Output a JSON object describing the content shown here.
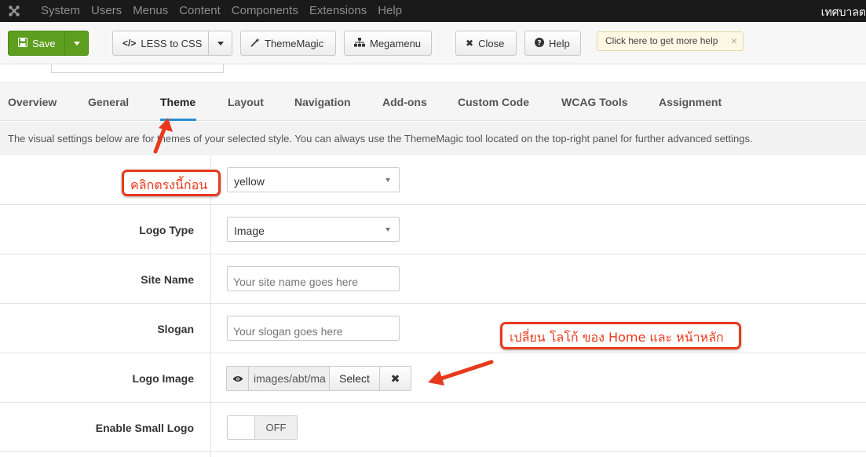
{
  "topbar": {
    "logo_icon": "joomla-icon",
    "menu": [
      "System",
      "Users",
      "Menus",
      "Content",
      "Components",
      "Extensions",
      "Help"
    ],
    "site_name": "เทศบาลต"
  },
  "toolbar": {
    "save": "Save",
    "less_to_css": "LESS to CSS",
    "theme_magic": "ThemeMagic",
    "megamenu": "Megamenu",
    "close": "Close",
    "help": "Help",
    "tip": "Click here to get more help",
    "tip_close": "×",
    "save_color": "#5e9e1f"
  },
  "tabs": {
    "items": [
      "Overview",
      "General",
      "Theme",
      "Layout",
      "Navigation",
      "Add-ons",
      "Custom Code",
      "WCAG Tools",
      "Assignment"
    ],
    "active": "Theme",
    "active_color": "#2c8fd4"
  },
  "description": "The visual settings below are for themes of your selected style. You can always use the ThemeMagic tool located on the top-right panel for further advanced settings.",
  "form": {
    "theme_value": "yellow",
    "logo_type_label": "Logo Type",
    "logo_type_value": "Image",
    "site_name_label": "Site Name",
    "site_name_placeholder": "Your site name goes here",
    "slogan_label": "Slogan",
    "slogan_placeholder": "Your slogan goes here",
    "logo_image_label": "Logo Image",
    "logo_image_value": "images/abt/ma",
    "logo_image_select": "Select",
    "logo_image_clear": "✖",
    "enable_small_logo_label": "Enable Small Logo",
    "enable_small_logo_value": "OFF"
  },
  "annotations": {
    "callout_1": "คลิกตรงนี้ก่อน",
    "callout_2": "เปลี่ยน โลโก้ ของ Home และ หน้าหลัก",
    "color": "#e8391c"
  }
}
